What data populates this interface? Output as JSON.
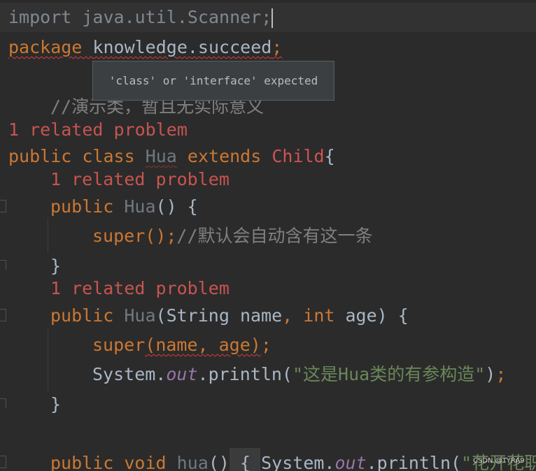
{
  "editor": {
    "line_import": {
      "kw": "import",
      "rest": " java.util.Scanner;"
    },
    "line_package": {
      "kw": "package",
      "name": "knowledge.succeed",
      "semi": ";"
    },
    "tooltip": {
      "text": "'class' or 'interface' expected"
    },
    "line_comment": {
      "text": "//演示类，暂且无实际意义"
    },
    "related_problem": "1 related problem",
    "line_class": {
      "kw1": "public",
      "kw2": "class",
      "name": "Hua",
      "kw3": "extends",
      "parent": "Child",
      "brace": "{"
    },
    "line_ctor1": {
      "kw": "public",
      "name": "Hua",
      "rest": "() {"
    },
    "line_super1": {
      "call": "super",
      "rest": "();",
      "comment": "//默认会自动含有这一条"
    },
    "close_brace": "}",
    "line_ctor2": {
      "kw": "public",
      "name": "Hua",
      "open": "(String name",
      "comma": ",",
      "kw_int": "int",
      "close": " age) {"
    },
    "line_super2": {
      "call": "super",
      "args": "(name, age)",
      "semi": ";"
    },
    "line_println": {
      "sys": "System.",
      "field": "out",
      "method": ".println(",
      "str": "\"这是Hua类的有参构造\"",
      "close": ")",
      "semi": ";"
    },
    "line_method": {
      "kw1": "public",
      "kw2": "void",
      "name": "hua",
      "parens": "()",
      "brace": "{",
      "sys": "System.",
      "field": "out",
      "method": ".println(",
      "str": "\"花开花职"
    }
  },
  "watermark": "CSDN @TYRA9"
}
